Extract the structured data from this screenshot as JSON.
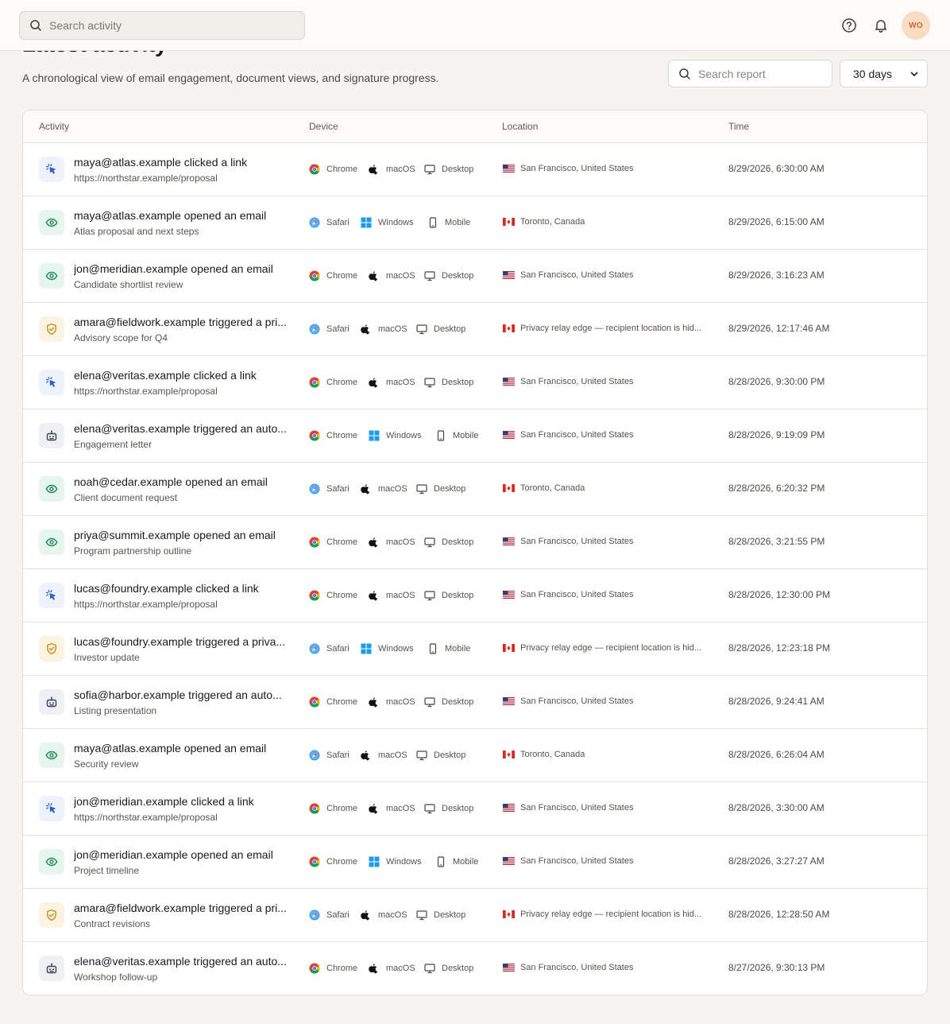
{
  "topbar": {
    "search_placeholder": "Search activity",
    "avatar_initials": "WO"
  },
  "page": {
    "title": "Latest activity",
    "subtitle": "A chronological view of email engagement, document views, and signature progress.",
    "report_search_placeholder": "Search report",
    "range_selected": "30 days"
  },
  "table": {
    "headers": {
      "activity": "Activity",
      "device": "Device",
      "location": "Location",
      "time": "Time"
    },
    "rows": [
      {
        "icon": "click",
        "title": "maya@atlas.example clicked a link",
        "subtitle": "https://northstar.example/proposal",
        "browser": "Chrome",
        "os": "macOS",
        "device": "Desktop",
        "country": "us",
        "location": "San Francisco, United States",
        "time": "8/29/2026, 6:30:00 AM"
      },
      {
        "icon": "open",
        "title": "maya@atlas.example opened an email",
        "subtitle": "Atlas proposal and next steps",
        "browser": "Safari",
        "os": "Windows",
        "device": "Mobile",
        "country": "ca",
        "location": "Toronto, Canada",
        "time": "8/29/2026, 6:15:00 AM"
      },
      {
        "icon": "open",
        "title": "jon@meridian.example opened an email",
        "subtitle": "Candidate shortlist review",
        "browser": "Chrome",
        "os": "macOS",
        "device": "Desktop",
        "country": "us",
        "location": "San Francisco, United States",
        "time": "8/29/2026, 3:16:23 AM"
      },
      {
        "icon": "privacy",
        "title": "amara@fieldwork.example triggered a pri...",
        "subtitle": "Advisory scope for Q4",
        "browser": "Safari",
        "os": "macOS",
        "device": "Desktop",
        "country": "ca",
        "location": "Privacy relay edge — recipient location is hid...",
        "time": "8/29/2026, 12:17:46 AM"
      },
      {
        "icon": "click",
        "title": "elena@veritas.example clicked a link",
        "subtitle": "https://northstar.example/proposal",
        "browser": "Chrome",
        "os": "macOS",
        "device": "Desktop",
        "country": "us",
        "location": "San Francisco, United States",
        "time": "8/28/2026, 9:30:00 PM"
      },
      {
        "icon": "auto",
        "title": "elena@veritas.example triggered an auto...",
        "subtitle": "Engagement letter",
        "browser": "Chrome",
        "os": "Windows",
        "device": "Mobile",
        "country": "us",
        "location": "San Francisco, United States",
        "time": "8/28/2026, 9:19:09 PM"
      },
      {
        "icon": "open",
        "title": "noah@cedar.example opened an email",
        "subtitle": "Client document request",
        "browser": "Safari",
        "os": "macOS",
        "device": "Desktop",
        "country": "ca",
        "location": "Toronto, Canada",
        "time": "8/28/2026, 6:20:32 PM"
      },
      {
        "icon": "open",
        "title": "priya@summit.example opened an email",
        "subtitle": "Program partnership outline",
        "browser": "Chrome",
        "os": "macOS",
        "device": "Desktop",
        "country": "us",
        "location": "San Francisco, United States",
        "time": "8/28/2026, 3:21:55 PM"
      },
      {
        "icon": "click",
        "title": "lucas@foundry.example clicked a link",
        "subtitle": "https://northstar.example/proposal",
        "browser": "Chrome",
        "os": "macOS",
        "device": "Desktop",
        "country": "us",
        "location": "San Francisco, United States",
        "time": "8/28/2026, 12:30:00 PM"
      },
      {
        "icon": "privacy",
        "title": "lucas@foundry.example triggered a priva...",
        "subtitle": "Investor update",
        "browser": "Safari",
        "os": "Windows",
        "device": "Mobile",
        "country": "ca",
        "location": "Privacy relay edge — recipient location is hid...",
        "time": "8/28/2026, 12:23:18 PM"
      },
      {
        "icon": "auto",
        "title": "sofia@harbor.example triggered an auto...",
        "subtitle": "Listing presentation",
        "browser": "Chrome",
        "os": "macOS",
        "device": "Desktop",
        "country": "us",
        "location": "San Francisco, United States",
        "time": "8/28/2026, 9:24:41 AM"
      },
      {
        "icon": "open",
        "title": "maya@atlas.example opened an email",
        "subtitle": "Security review",
        "browser": "Safari",
        "os": "macOS",
        "device": "Desktop",
        "country": "ca",
        "location": "Toronto, Canada",
        "time": "8/28/2026, 6:26:04 AM"
      },
      {
        "icon": "click",
        "title": "jon@meridian.example clicked a link",
        "subtitle": "https://northstar.example/proposal",
        "browser": "Chrome",
        "os": "macOS",
        "device": "Desktop",
        "country": "us",
        "location": "San Francisco, United States",
        "time": "8/28/2026, 3:30:00 AM"
      },
      {
        "icon": "open",
        "title": "jon@meridian.example opened an email",
        "subtitle": "Project timeline",
        "browser": "Chrome",
        "os": "Windows",
        "device": "Mobile",
        "country": "us",
        "location": "San Francisco, United States",
        "time": "8/28/2026, 3:27:27 AM"
      },
      {
        "icon": "privacy",
        "title": "amara@fieldwork.example triggered a pri...",
        "subtitle": "Contract revisions",
        "browser": "Safari",
        "os": "macOS",
        "device": "Desktop",
        "country": "ca",
        "location": "Privacy relay edge — recipient location is hid...",
        "time": "8/28/2026, 12:28:50 AM"
      },
      {
        "icon": "auto",
        "title": "elena@veritas.example triggered an auto...",
        "subtitle": "Workshop follow-up",
        "browser": "Chrome",
        "os": "macOS",
        "device": "Desktop",
        "country": "us",
        "location": "San Francisco, United States",
        "time": "8/27/2026, 9:30:13 PM"
      }
    ]
  }
}
